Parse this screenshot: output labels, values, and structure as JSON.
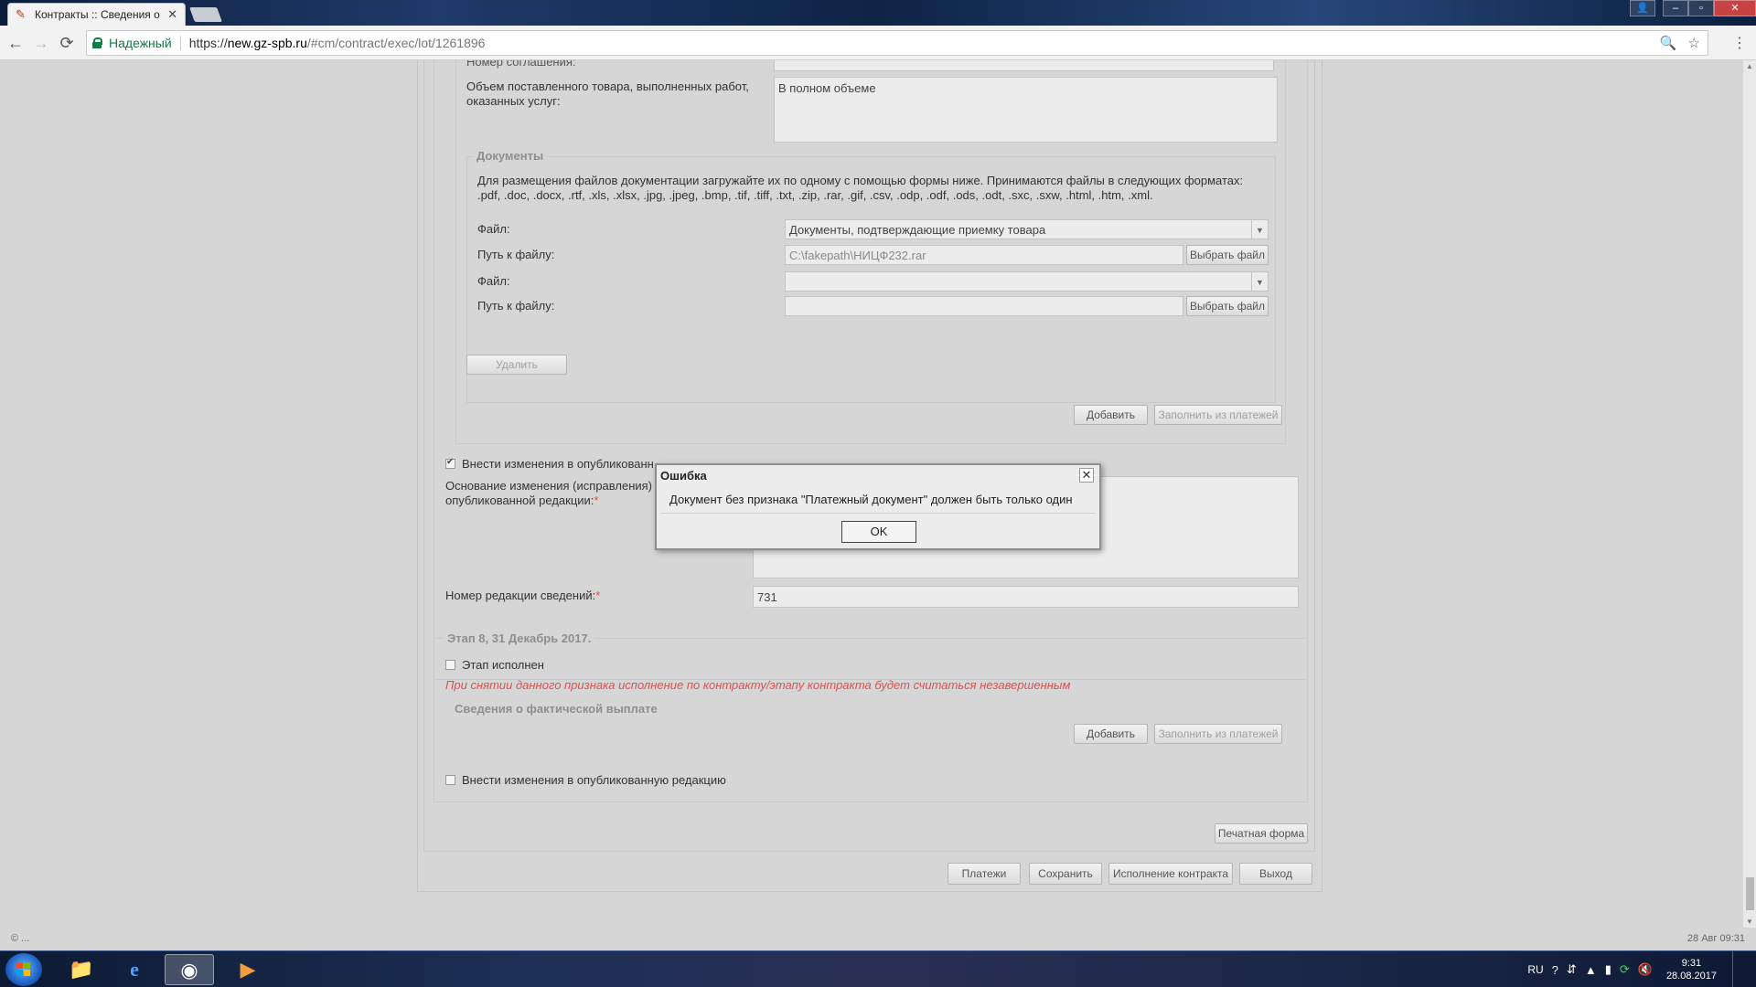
{
  "browser": {
    "tab_title": "Контракты :: Сведения о",
    "tab_close": "✕",
    "secure_label": "Надежный",
    "url_scheme": "https://",
    "url_host": "new.gz-spb.ru",
    "url_path": "/#cm/contract/exec/lot/1261896",
    "icons": {
      "back": "←",
      "forward": "→",
      "reload": "⟳",
      "zoom": "🔍",
      "star": "☆",
      "menu": "⋮"
    }
  },
  "form": {
    "agreement_number_label": "Номер соглашения:",
    "volume_label": "Объем поставленного товара, выполненных работ, оказанных услуг:",
    "volume_value": "В полном объеме",
    "documents_legend": "Документы",
    "documents_hint": "Для размещения файлов документации загружайте их по одному с помощью формы ниже. Принимаются файлы в следующих форматах: .pdf, .doc, .docx, .rtf, .xls, .xlsx, .jpg, .jpeg, .bmp, .tif, .tiff, .txt, .zip, .rar, .gif, .csv, .odp, .odf, .ods, .odt, .sxc, .sxw, .html, .htm, .xml.",
    "file_label": "Файл:",
    "path_label": "Путь к файлу:",
    "file1_value": "Документы, подтверждающие приемку товара",
    "path1_value": "C:\\fakepath\\НИЦФ232.rar",
    "file2_value": "",
    "path2_value": "",
    "choose_file_btn": "Выбрать файл",
    "delete_btn": "Удалить",
    "add_btn": "Добавить",
    "fill_from_payments_btn": "Заполнить из платежей",
    "change_published_label": "Внести изменения в опубликованную редакцию",
    "change_published_label_cut": "Внести изменения в опубликованн",
    "change_reason_label_1": "Основание изменения (исправления)",
    "change_reason_label_2": "опубликованной редакции:",
    "required_mark": "*",
    "revision_number_label": "Номер редакции сведений:",
    "revision_number_value": "731",
    "stage_legend": "Этап 8, 31 Декабрь 2017.",
    "stage_done_label": "Этап исполнен",
    "stage_warning": "При снятии данного признака исполнение по контракту/этапу контракта будет считаться незавершенным",
    "actual_payment_label": "Сведения о фактической выплате",
    "print_form_btn": "Печатная форма",
    "payments_btn": "Платежи",
    "save_btn": "Сохранить",
    "contract_exec_btn": "Исполнение контракта",
    "exit_btn": "Выход"
  },
  "modal": {
    "title": "Ошибка",
    "message": "Документ без признака \"Платежный документ\" должен быть только один",
    "ok_label": "OK",
    "close_glyph": "✕"
  },
  "status": {
    "left": "© ...",
    "right": "28 Авг 09:31"
  },
  "taskbar": {
    "lang": "RU",
    "time": "9:31",
    "date": "28.08.2017",
    "apps": [
      "explorer",
      "internet-explorer",
      "chrome",
      "media-player"
    ]
  }
}
